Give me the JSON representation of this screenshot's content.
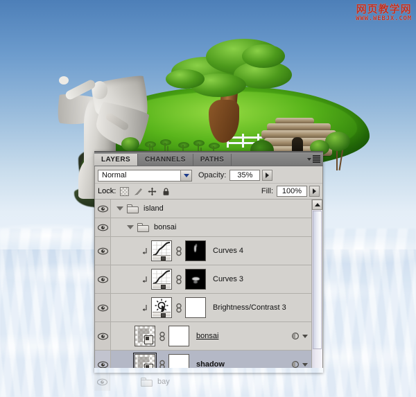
{
  "watermark": {
    "chinese": "网页教学网",
    "url": "WWW.WEBJX.COM"
  },
  "panel": {
    "tabs": [
      {
        "label": "LAYERS",
        "active": true
      },
      {
        "label": "CHANNELS",
        "active": false
      },
      {
        "label": "PATHS",
        "active": false
      }
    ],
    "menu_icon": "panel-menu-icon",
    "blend_mode": {
      "value": "Normal",
      "dropdown_icon": "chevron-down-icon"
    },
    "opacity": {
      "label": "Opacity:",
      "value": "35%",
      "spinner_icon": "triangle-right-icon"
    },
    "fill": {
      "label": "Fill:",
      "value": "100%",
      "spinner_icon": "triangle-right-icon"
    },
    "lock": {
      "label": "Lock:",
      "icons": [
        "lock-transparent-pixels-icon",
        "lock-image-pixels-icon",
        "lock-position-icon",
        "lock-all-icon"
      ]
    },
    "scrollbar": {
      "up_arrow_icon": "scroll-up-arrow-icon"
    },
    "layers": [
      {
        "name": "island",
        "type": "group",
        "indent": 0,
        "visible": true,
        "expanded": true,
        "selected": false,
        "style": "normal"
      },
      {
        "name": "bonsai",
        "type": "group",
        "indent": 1,
        "visible": true,
        "expanded": true,
        "selected": false,
        "style": "normal"
      },
      {
        "name": "Curves 4",
        "type": "adjustment-curves",
        "indent": 2,
        "visible": true,
        "clipped": true,
        "selected": false,
        "mask": "black",
        "style": "normal"
      },
      {
        "name": "Curves 3",
        "type": "adjustment-curves",
        "indent": 2,
        "visible": true,
        "clipped": true,
        "selected": false,
        "mask": "black",
        "style": "normal"
      },
      {
        "name": "Brightness/Contrast 3",
        "type": "adjustment-brightness-contrast",
        "indent": 2,
        "visible": true,
        "clipped": true,
        "selected": false,
        "mask": "white",
        "style": "normal"
      },
      {
        "name": "bonsai",
        "type": "pixel",
        "indent": 1,
        "visible": true,
        "clipped": false,
        "selected": false,
        "mask": "white",
        "style": "underline",
        "has_fx": true
      },
      {
        "name": "shadow",
        "type": "pixel",
        "indent": 1,
        "visible": true,
        "clipped": false,
        "selected": true,
        "mask": "white",
        "style": "bold",
        "has_fx": true
      },
      {
        "name": "bay",
        "type": "group",
        "indent": 0,
        "visible": true,
        "selected": false,
        "style": "ghost"
      }
    ]
  },
  "artwork": {
    "description": "floating island with angel statue, bonsai tree, stone house above a sea of clouds",
    "sky_color": "#6d9ccd",
    "grass_color": "#4aa314",
    "cloud_color": "#eaf1f9"
  }
}
